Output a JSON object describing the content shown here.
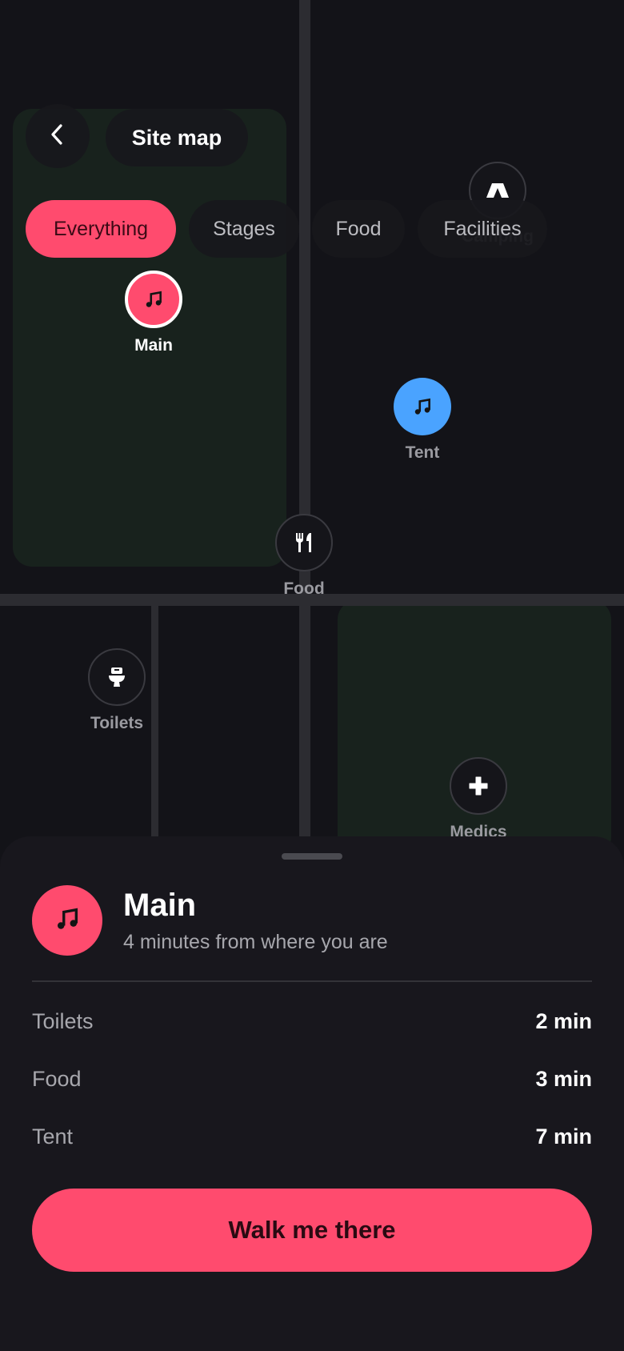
{
  "header": {
    "title": "Site map"
  },
  "filters": [
    {
      "label": "Everything",
      "active": true
    },
    {
      "label": "Stages",
      "active": false
    },
    {
      "label": "Food",
      "active": false
    },
    {
      "label": "Facilities",
      "active": false
    }
  ],
  "map": {
    "pois": [
      {
        "name": "Camping",
        "icon": "tent-icon"
      },
      {
        "name": "Main",
        "icon": "music-note-icon",
        "selected": true
      },
      {
        "name": "Tent",
        "icon": "music-note-icon"
      },
      {
        "name": "Food",
        "icon": "fork-knife-icon"
      },
      {
        "name": "Toilets",
        "icon": "toilet-icon"
      },
      {
        "name": "Medics",
        "icon": "medical-cross-icon"
      }
    ]
  },
  "sheet": {
    "title": "Main",
    "subtitle": "4 minutes from where you are",
    "icon": "music-note-icon",
    "nearby": [
      {
        "name": "Toilets",
        "time": "2 min"
      },
      {
        "name": "Food",
        "time": "3 min"
      },
      {
        "name": "Tent",
        "time": "7 min"
      }
    ],
    "cta_label": "Walk me there"
  },
  "colors": {
    "accent": "#ff4b6e",
    "stage_secondary": "#4aa3ff",
    "background": "#131318",
    "zone": "#18221d"
  }
}
